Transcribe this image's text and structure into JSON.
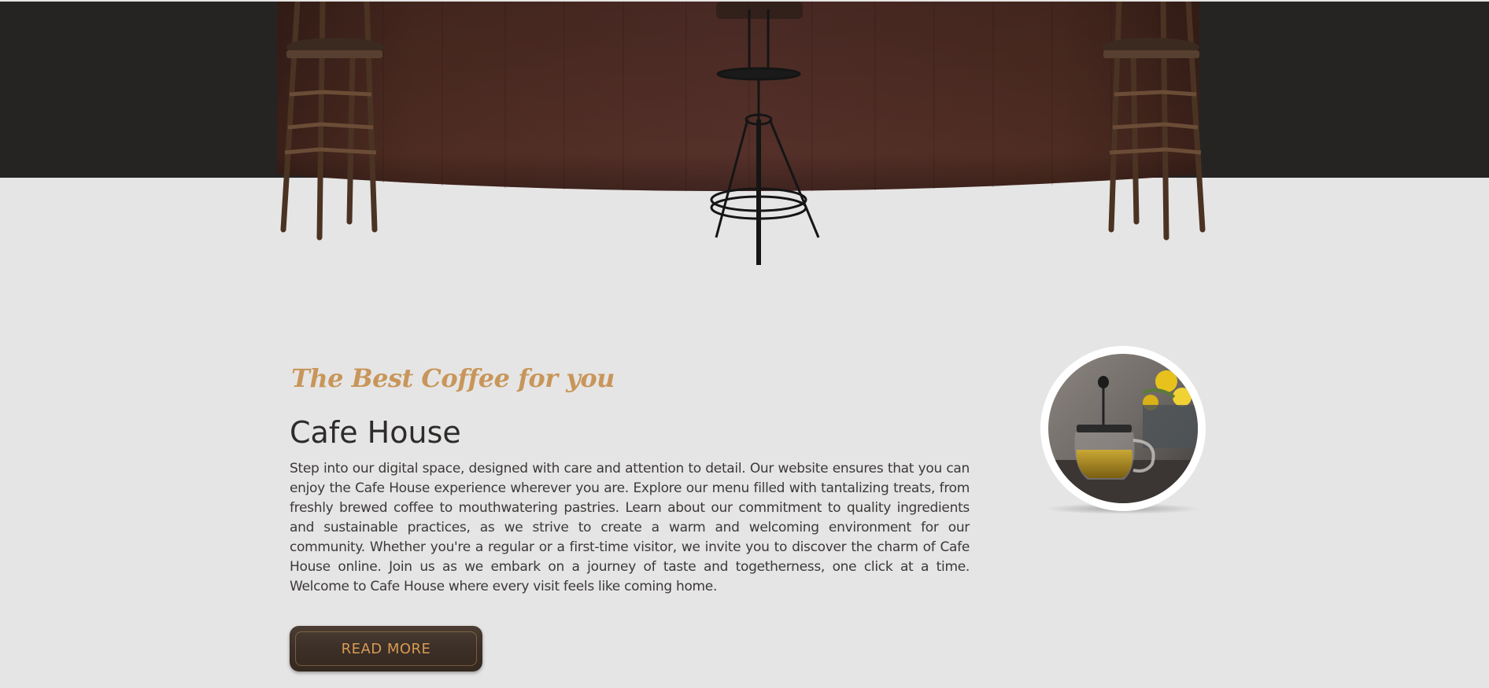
{
  "hero": {
    "colors": {
      "dark_band": "#252423",
      "wood": "#4a2a20",
      "page_bg": "#e6e5e5"
    }
  },
  "intro": {
    "tagline": "The Best Coffee for you",
    "title": "Cafe House",
    "body": "Step into our digital space, designed with care and attention to detail. Our website ensures that you can enjoy the Cafe House experience wherever you are. Explore our menu filled with tantalizing treats, from freshly brewed coffee to mouthwatering pastries. Learn about our commitment to quality ingredients and sustainable practices, as we strive to create a warm and welcoming environment for our community. Whether you're a regular or a first-time visitor, we invite you to discover the charm of Cafe House online. Join us as we embark on a journey of taste and togetherness, one click at a time. Welcome to Cafe House where every visit feels like coming home.",
    "read_more_label": "READ MORE",
    "accent_color": "#c8965a"
  },
  "photo": {
    "subject": "french-press-teapot-with-yellow-flowers"
  }
}
